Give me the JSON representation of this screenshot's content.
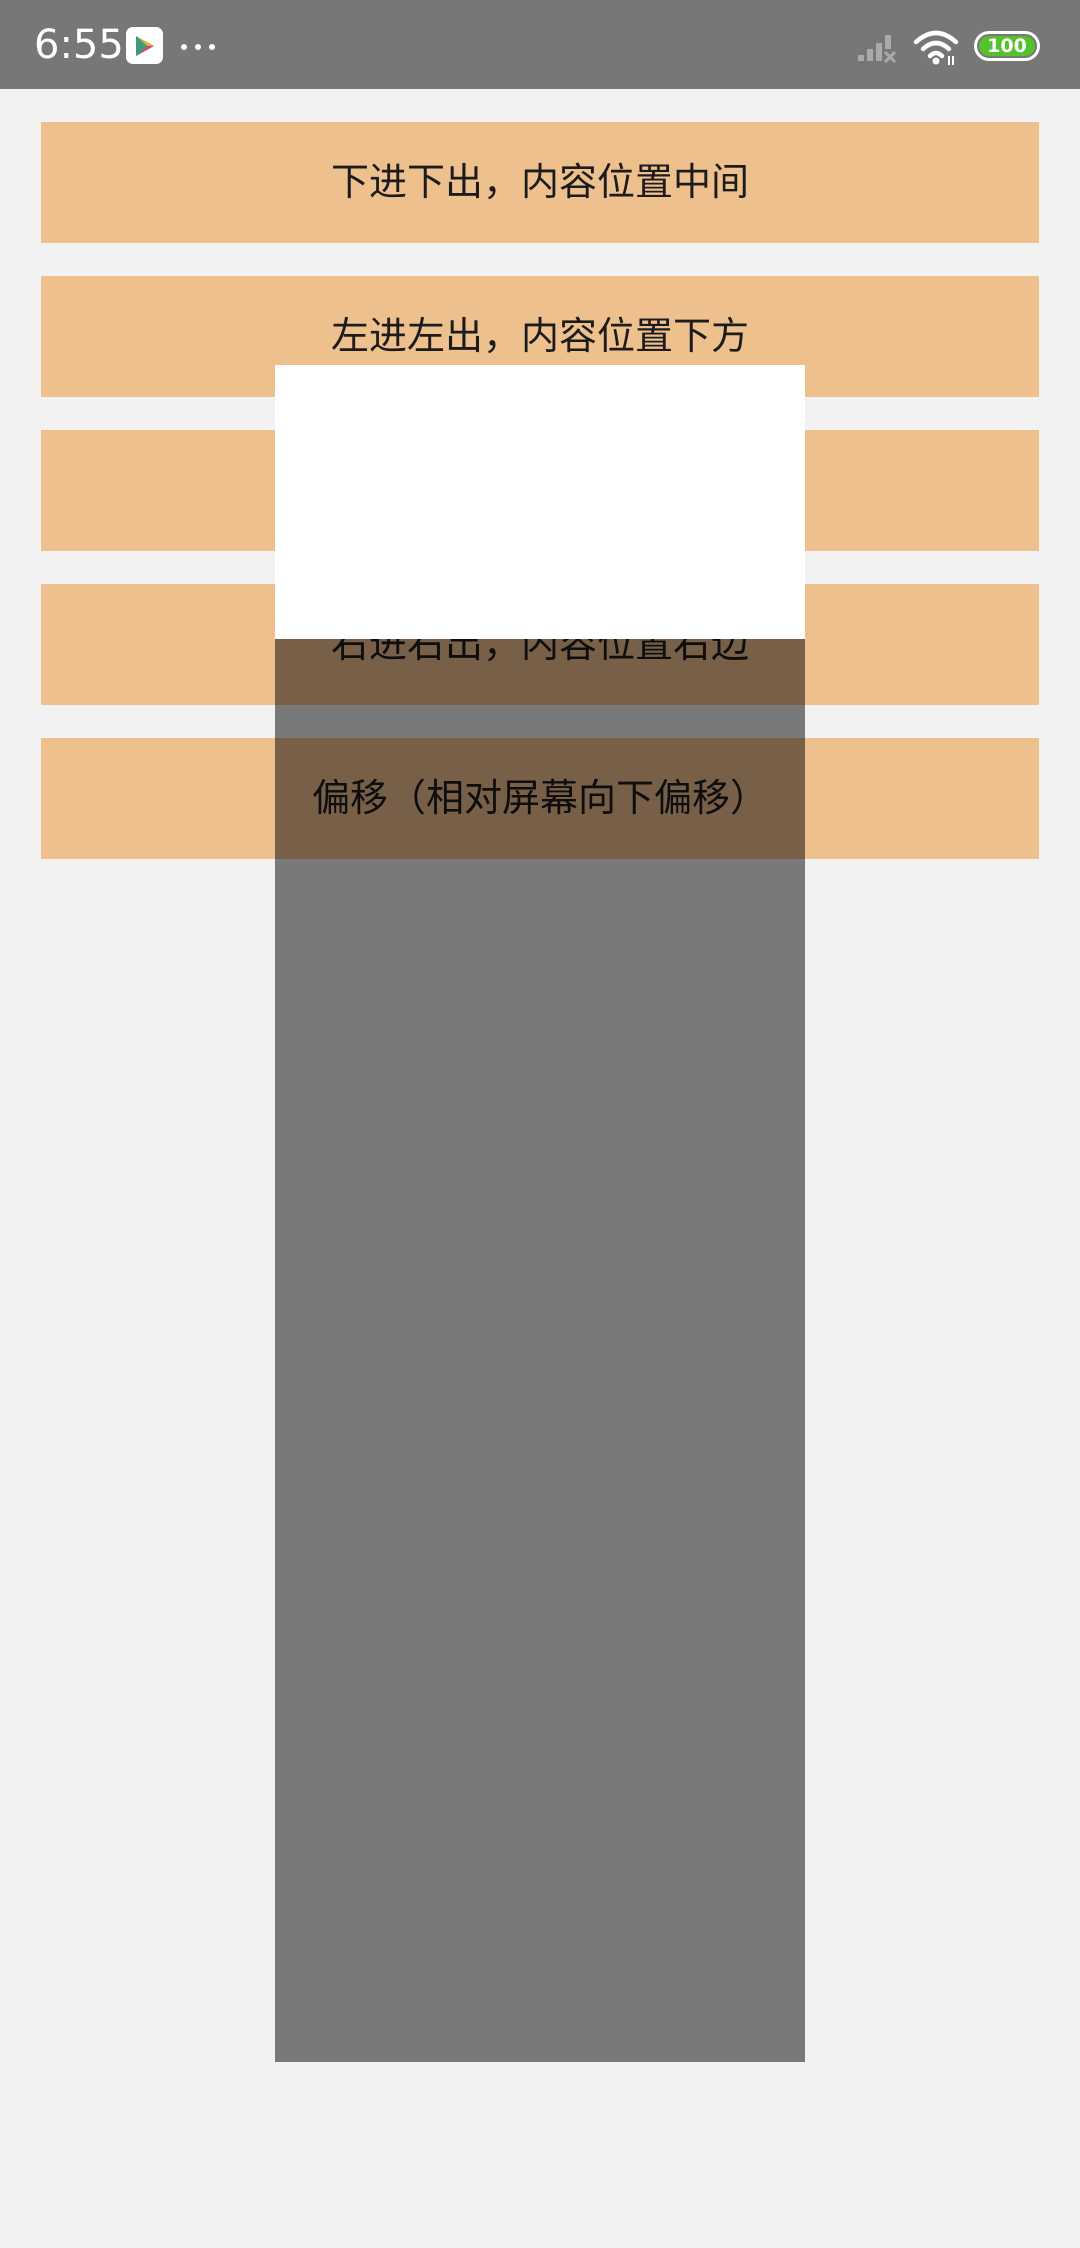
{
  "status_bar": {
    "time": "6:55",
    "app_icon": "play-store-icon",
    "more_icon": "more-dots-icon",
    "signal_icon": "signal-none-icon",
    "wifi_icon": "wifi-icon",
    "battery_level": "100",
    "battery_color": "#55c22d"
  },
  "buttons": [
    {
      "label": "下进下出，内容位置中间"
    },
    {
      "label": "左进左出，内容位置下方"
    },
    {
      "label": ""
    },
    {
      "label": "右进右出，内容位置右边"
    },
    {
      "label": "偏移（相对屏幕向下偏移）"
    }
  ],
  "colors": {
    "button_bg": "#eec08e",
    "page_bg": "#f2f2f2",
    "status_bar_bg": "#777777",
    "popup_bg": "#ffffff",
    "overlay": "rgba(0,0,0,0.5)"
  }
}
